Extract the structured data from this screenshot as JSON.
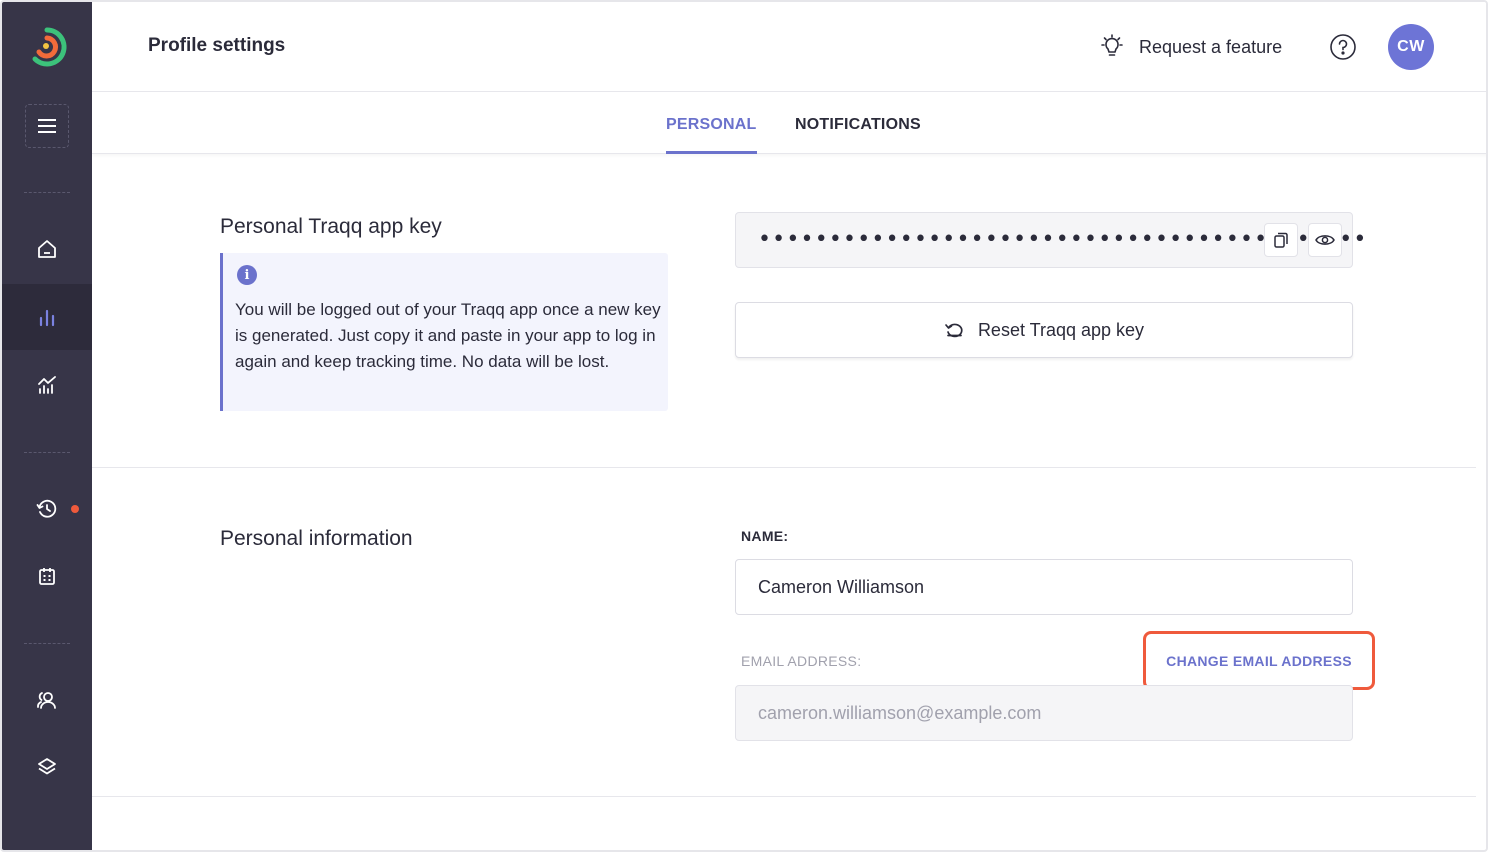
{
  "header": {
    "title": "Profile settings",
    "feature_label": "Request a feature",
    "avatar_initials": "CW"
  },
  "tabs": [
    {
      "label": "PERSONAL",
      "active": true
    },
    {
      "label": "NOTIFICATIONS",
      "active": false
    }
  ],
  "app_key": {
    "title": "Personal Traqq app key",
    "info_text": "You will be logged out of your Traqq app once a new key is generated. Just copy it and paste in your app to log in again and keep tracking time. No data will be lost.",
    "masked_value": "•••••••••••••••••••••••••••••••••••••••••••",
    "reset_label": "Reset Traqq app key"
  },
  "personal_info": {
    "title": "Personal information",
    "name_label": "NAME:",
    "name_value": "Cameron Williamson",
    "email_label": "EMAIL ADDRESS:",
    "email_value": "cameron.williamson@example.com",
    "change_email_label": "CHANGE EMAIL ADDRESS"
  },
  "sidebar": {
    "items": [
      "home-icon",
      "bar-chart-icon",
      "analytics-icon",
      "history-icon",
      "calendar-icon",
      "users-icon",
      "layers-icon"
    ],
    "active_item": "bar-chart-icon",
    "notification_dot": true
  },
  "colors": {
    "accent": "#6b72cc",
    "sidebar_bg": "#373548",
    "highlight": "#ef5a3c",
    "logo_orange": "#f26b3a",
    "logo_green": "#3cc27b"
  }
}
